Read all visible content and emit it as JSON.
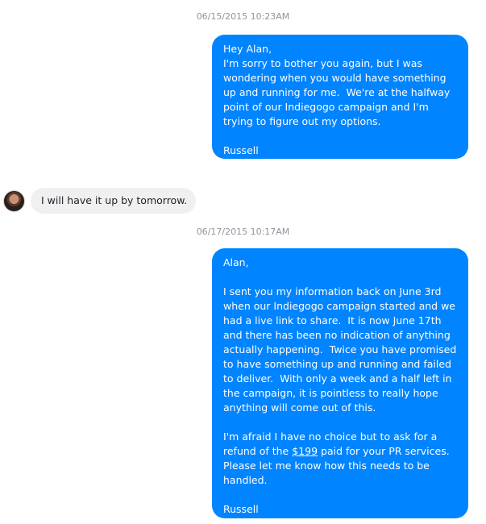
{
  "thread": {
    "timestamp_1": "06/15/2015 10:23AM",
    "message_1": {
      "greeting": "Hey Alan,",
      "body": "I'm sorry to bother you again, but I was wondering when you would have something up and running for me.  We're at the halfway point of our Indiegogo campaign and I'm trying to figure out my options.",
      "signature": "Russell"
    },
    "reply_1": "I will have it up by tomorrow.",
    "timestamp_2": "06/17/2015 10:17AM",
    "message_2": {
      "greeting": "Alan,",
      "para_1": "I sent you my information back on June 3rd when our Indiegogo campaign started and we had a live link to share.  It is now June 17th and there has been no indication of anything actually happening.  Twice you have promised to have something up and running and failed to deliver.  With only a week and a half left in the campaign, it is pointless to really hope anything will come out of this.",
      "para_2_pre": "I'm afraid I have no choice but to ask for a refund of the ",
      "para_2_amount": "$199",
      "para_2_post": " paid for your PR services.  Please let me know how this needs to be handled.",
      "signature": "Russell"
    }
  },
  "colors": {
    "outgoing_bubble": "#0084ff",
    "incoming_bubble": "#f1f0f0",
    "timestamp_text": "#90949c"
  }
}
